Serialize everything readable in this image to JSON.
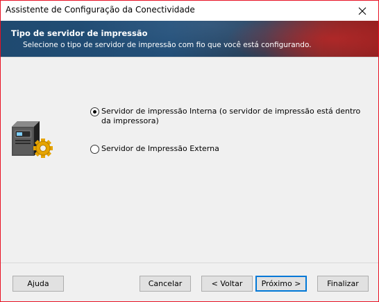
{
  "window": {
    "title": "Assistente de Configuração da Conectividade"
  },
  "banner": {
    "title": "Tipo de servidor de impressão",
    "subtitle": "Selecione o tipo de servidor de impressão com fio que você está configurando."
  },
  "options": [
    {
      "label": "Servidor de impressão Interna (o servidor de impressão está dentro da impressora)",
      "selected": true
    },
    {
      "label": "Servidor de Impressão Externa",
      "selected": false
    }
  ],
  "buttons": {
    "help": "Ajuda",
    "cancel": "Cancelar",
    "back": "< Voltar",
    "next": "Próximo >",
    "finish": "Finalizar"
  },
  "icons": {
    "close": "close-icon",
    "printer": "print-server-icon"
  }
}
